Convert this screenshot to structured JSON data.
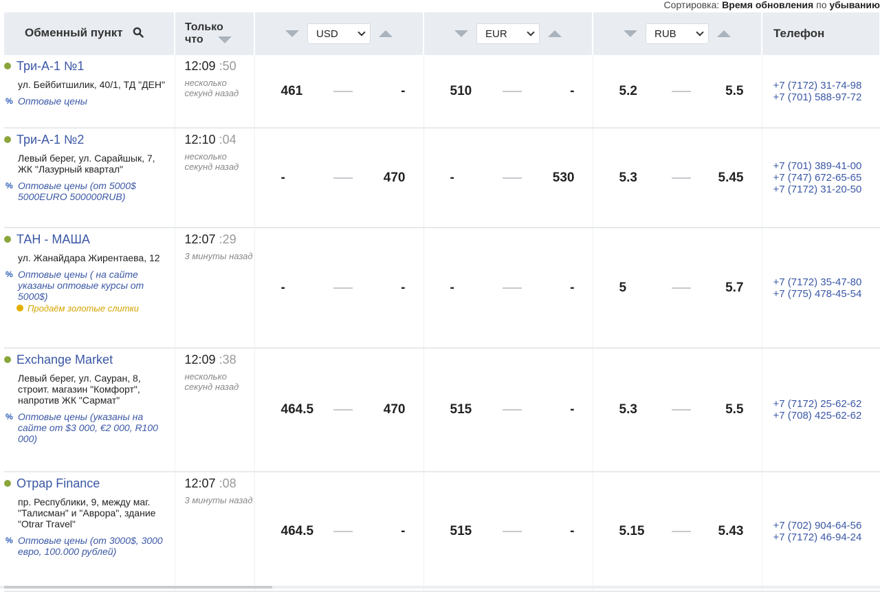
{
  "sort": {
    "label": "Сортировка:",
    "field": "Время обновления",
    "by": "по",
    "order": "убыванию"
  },
  "header": {
    "point": "Обменный пункт",
    "time": "Только что",
    "phone": "Телефон",
    "currencies": [
      "USD",
      "EUR",
      "RUB"
    ]
  },
  "rows": [
    {
      "name": "Три-А-1 №1",
      "address": "ул. Бейбитшилик, 40/1, ТД \"ДЕН\"",
      "wholesale": "Оптовые цены",
      "gold": "",
      "time": "12:09",
      "sec": ":50",
      "ago": "несколько секунд назад",
      "usd": {
        "buy": "461",
        "sell": "-"
      },
      "eur": {
        "buy": "510",
        "sell": "-"
      },
      "rub": {
        "buy": "5.2",
        "sell": "5.5"
      },
      "phones": [
        "+7 (7172) 31-74-98",
        "+7 (701) 588-97-72"
      ]
    },
    {
      "name": "Три-А-1 №2",
      "address": "Левый берег, ул. Сарайшык, 7, ЖК \"Лазурный квартал\"",
      "wholesale": "Оптовые цены (от 5000$ 5000EURO 500000RUB)",
      "gold": "",
      "time": "12:10",
      "sec": ":04",
      "ago": "несколько секунд назад",
      "usd": {
        "buy": "-",
        "sell": "470"
      },
      "eur": {
        "buy": "-",
        "sell": "530"
      },
      "rub": {
        "buy": "5.3",
        "sell": "5.45"
      },
      "phones": [
        "+7 (701) 389-41-00",
        "+7 (747) 672-65-65",
        "+7 (7172) 31-20-50"
      ]
    },
    {
      "name": "ТАН - МАША",
      "address": "ул. Жанайдара Жирентаева, 12",
      "wholesale": "Оптовые цены ( на сайте указаны оптовые курсы от 5000$)",
      "gold": "Продаём золотые слитки",
      "time": "12:07",
      "sec": ":29",
      "ago": "3 минуты назад",
      "usd": {
        "buy": "-",
        "sell": "-"
      },
      "eur": {
        "buy": "-",
        "sell": "-"
      },
      "rub": {
        "buy": "5",
        "sell": "5.7"
      },
      "phones": [
        "+7 (7172) 35-47-80",
        "+7 (775) 478-45-54"
      ]
    },
    {
      "name": "Exchange Market",
      "address": "Левый берег, ул. Сауран, 8, строит. магазин \"Комфорт\", напротив ЖК \"Сармат\"",
      "wholesale": "Оптовые цены (указаны на сайте от $3 000, €2 000, R100 000)",
      "gold": "",
      "time": "12:09",
      "sec": ":38",
      "ago": "несколько секунд назад",
      "usd": {
        "buy": "464.5",
        "sell": "470"
      },
      "eur": {
        "buy": "515",
        "sell": "-"
      },
      "rub": {
        "buy": "5.3",
        "sell": "5.5"
      },
      "phones": [
        "+7 (7172) 25-62-62",
        "+7 (708) 425-62-62"
      ]
    },
    {
      "name": "Отрар Finance",
      "address": "пр. Республики, 9, между маг. \"Талисман\" и \"Аврора\", здание \"Otrar Travel\"",
      "wholesale": "Оптовые цены (от 3000$, 3000 евро, 100.000 рублей)",
      "gold": "",
      "time": "12:07",
      "sec": ":08",
      "ago": "3 минуты назад",
      "usd": {
        "buy": "464.5",
        "sell": "-"
      },
      "eur": {
        "buy": "515",
        "sell": "-"
      },
      "rub": {
        "buy": "5.15",
        "sell": "5.43"
      },
      "phones": [
        "+7 (702) 904-64-56",
        "+7 (7172) 46-94-24"
      ]
    }
  ]
}
